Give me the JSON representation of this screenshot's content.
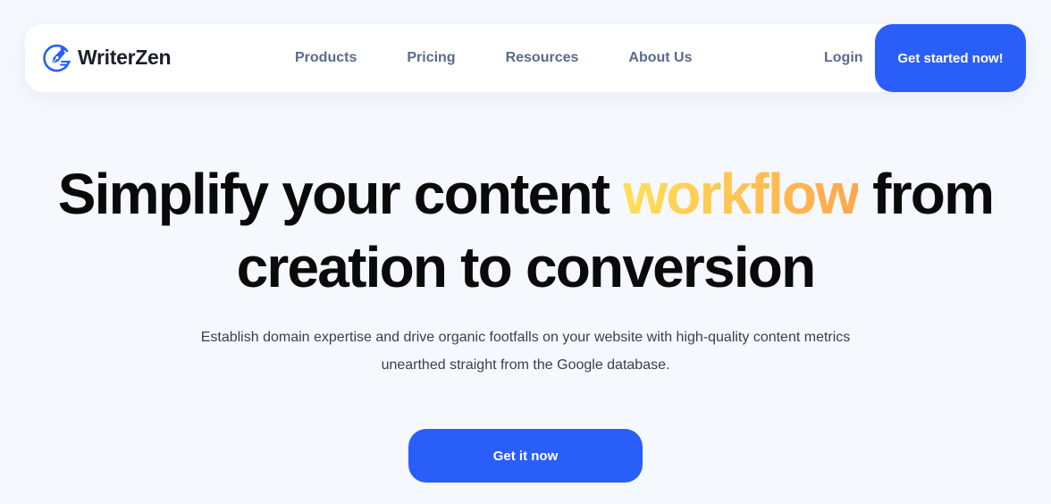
{
  "brand": {
    "name": "WriterZen",
    "icon": "fountain-pen-nib-icon",
    "color": "#2a5ef8"
  },
  "nav": {
    "links": [
      {
        "label": "Products"
      },
      {
        "label": "Pricing"
      },
      {
        "label": "Resources"
      },
      {
        "label": "About Us"
      }
    ],
    "login_label": "Login",
    "cta_label": "Get started now!"
  },
  "hero": {
    "title_before": "Simplify your content ",
    "title_highlight": "workflow",
    "title_after_line1": " from",
    "title_line2": "creation to conversion",
    "subtitle_line1": "Establish domain expertise and drive organic footfalls on your website with high-quality content metrics",
    "subtitle_line2": "unearthed straight from the Google database.",
    "cta_label": "Get it now",
    "highlight_gradient": [
      "#ffe056",
      "#ffa64d"
    ]
  },
  "colors": {
    "background": "#f5f8fd",
    "accent": "#2a5ef8",
    "nav_text": "#5a6a8c",
    "heading": "#0a0a0a"
  }
}
